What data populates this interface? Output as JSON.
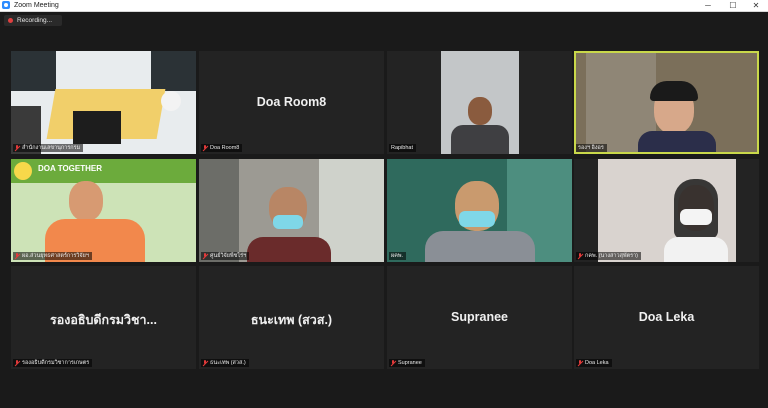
{
  "window": {
    "title": "Zoom Meeting",
    "minimize": "─",
    "maximize": "☐",
    "close": "✕"
  },
  "recording": {
    "label": "Recording..."
  },
  "participants": [
    {
      "name": "สำนักงานเลขานุการกรม",
      "display_name": "",
      "video": true
    },
    {
      "name": "Doa Room8",
      "display_name": "Doa Room8",
      "video": false
    },
    {
      "name": "Rapibhat",
      "display_name": "",
      "video": true
    },
    {
      "name": "รองฯ อิงอร",
      "display_name": "",
      "video": true,
      "active_speaker": true
    },
    {
      "name": "ผอ.ส่วนยุทธศาสตร์การวิจัยฯ",
      "display_name": "",
      "video": true,
      "logo_text": "DOA TOGETHER"
    },
    {
      "name": "ศูนย์วิจัยพืชไร่ฯ",
      "display_name": "",
      "video": true
    },
    {
      "name": "ผคพ.",
      "display_name": "",
      "video": true
    },
    {
      "name": "กคพ. (นางสาวสุพัตรา)",
      "display_name": "",
      "video": true
    },
    {
      "name": "รองอธิบดีกรมวิชาการเกษตร",
      "display_name": "รองอธิบดีกรมวิชา...",
      "video": false
    },
    {
      "name": "ธนะเทพ (สวส.)",
      "display_name": "ธนะเทพ (สวส.)",
      "video": false
    },
    {
      "name": "Supranee",
      "display_name": "Supranee",
      "video": false
    },
    {
      "name": "Doa Leka",
      "display_name": "Doa Leka",
      "video": false
    }
  ],
  "colors": {
    "active_outline": "#c9d84a",
    "muted_mic": "#e23a3a",
    "tile_bg": "#232323"
  }
}
